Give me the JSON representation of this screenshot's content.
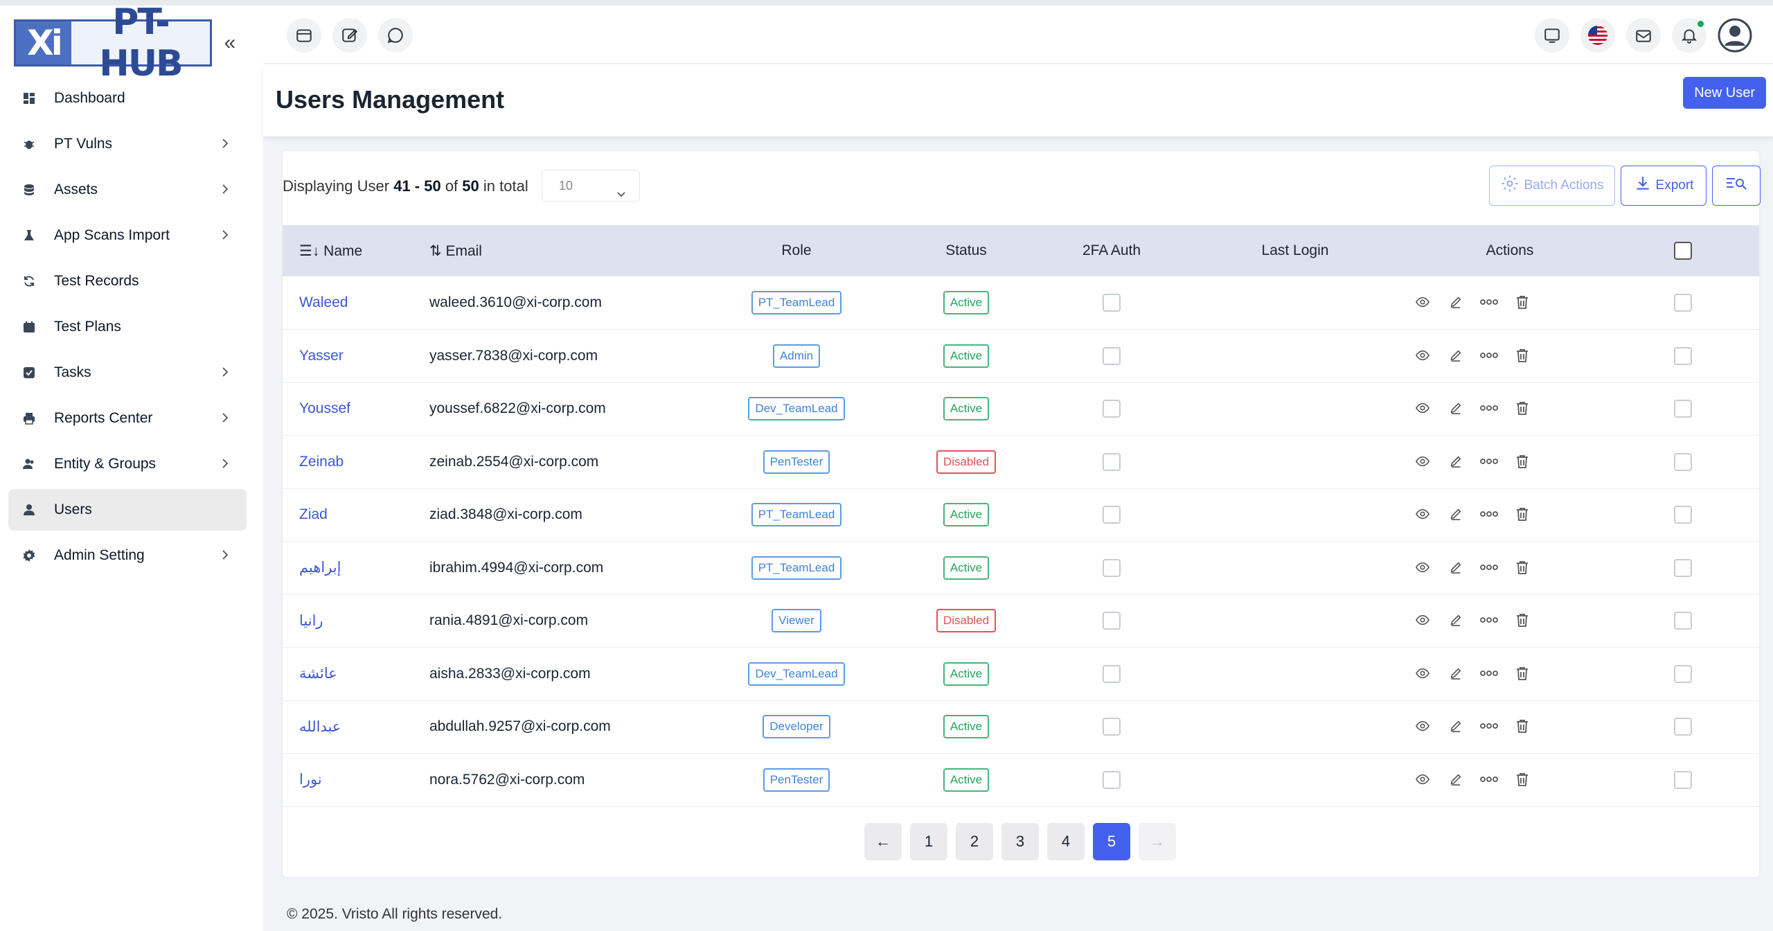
{
  "brand": {
    "logo_left": "Xi",
    "logo_right": "PT-HUB"
  },
  "sidebar": {
    "items": [
      {
        "label": "Dashboard",
        "icon": "dashboard-icon",
        "chevron": false
      },
      {
        "label": "PT Vulns",
        "icon": "bug-icon",
        "chevron": true
      },
      {
        "label": "Assets",
        "icon": "database-icon",
        "chevron": true
      },
      {
        "label": "App Scans Import",
        "icon": "flask-icon",
        "chevron": true
      },
      {
        "label": "Test Records",
        "icon": "refresh-icon",
        "chevron": false
      },
      {
        "label": "Test Plans",
        "icon": "calendar-icon",
        "chevron": false
      },
      {
        "label": "Tasks",
        "icon": "checkbox-icon",
        "chevron": true
      },
      {
        "label": "Reports Center",
        "icon": "printer-icon",
        "chevron": true
      },
      {
        "label": "Entity & Groups",
        "icon": "users-group-icon",
        "chevron": true
      },
      {
        "label": "Users",
        "icon": "user-icon",
        "chevron": false,
        "active": true
      },
      {
        "label": "Admin Setting",
        "icon": "gear-icon",
        "chevron": true
      }
    ]
  },
  "page": {
    "title": "Users Management",
    "new_user_label": "New User"
  },
  "listing": {
    "prefix": "Displaying User",
    "range": "41 - 50",
    "of": "of",
    "total": "50",
    "suffix": "in total",
    "page_size": "10"
  },
  "toolbar": {
    "batch_actions": "Batch Actions",
    "export": "Export"
  },
  "table": {
    "headers": {
      "name": "Name",
      "email": "Email",
      "role": "Role",
      "status": "Status",
      "twofa": "2FA Auth",
      "last_login": "Last Login",
      "actions": "Actions"
    },
    "rows": [
      {
        "name": "Waleed",
        "email": "waleed.3610@xi-corp.com",
        "role": "PT_TeamLead",
        "status": "Active"
      },
      {
        "name": "Yasser",
        "email": "yasser.7838@xi-corp.com",
        "role": "Admin",
        "status": "Active"
      },
      {
        "name": "Youssef",
        "email": "youssef.6822@xi-corp.com",
        "role": "Dev_TeamLead",
        "status": "Active"
      },
      {
        "name": "Zeinab",
        "email": "zeinab.2554@xi-corp.com",
        "role": "PenTester",
        "status": "Disabled"
      },
      {
        "name": "Ziad",
        "email": "ziad.3848@xi-corp.com",
        "role": "PT_TeamLead",
        "status": "Active"
      },
      {
        "name": "إبراهيم",
        "email": "ibrahim.4994@xi-corp.com",
        "role": "PT_TeamLead",
        "status": "Active"
      },
      {
        "name": "رانيا",
        "email": "rania.4891@xi-corp.com",
        "role": "Viewer",
        "status": "Disabled"
      },
      {
        "name": "عائشة",
        "email": "aisha.2833@xi-corp.com",
        "role": "Dev_TeamLead",
        "status": "Active"
      },
      {
        "name": "عبدالله",
        "email": "abdullah.9257@xi-corp.com",
        "role": "Developer",
        "status": "Active"
      },
      {
        "name": "نورا",
        "email": "nora.5762@xi-corp.com",
        "role": "PenTester",
        "status": "Active"
      }
    ]
  },
  "pagination": {
    "prev": "←",
    "pages": [
      "1",
      "2",
      "3",
      "4",
      "5"
    ],
    "current": "5",
    "next": "→"
  },
  "footer": {
    "text": "© 2025. Vristo All rights reserved."
  },
  "colors": {
    "primary": "#4361ee",
    "active_green": "#24a35a",
    "disabled_red": "#e7515a",
    "role_blue": "#3f83d9"
  }
}
